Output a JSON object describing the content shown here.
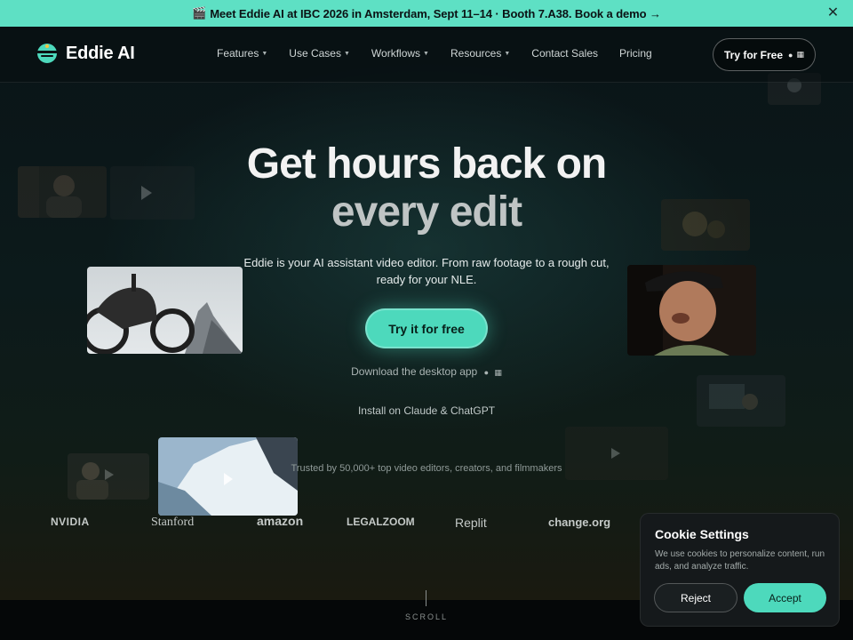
{
  "announcement": {
    "icon": "clapperboard-icon",
    "text": "Meet Eddie AI at IBC 2026 in Amsterdam, Sept 11–14 · Booth 7.A38. Book a demo →",
    "close": "✕"
  },
  "nav": {
    "brand": "Eddie AI",
    "items": [
      {
        "label": "Features",
        "dropdown": true
      },
      {
        "label": "Use Cases",
        "dropdown": true
      },
      {
        "label": "Workflows",
        "dropdown": true
      },
      {
        "label": "Resources",
        "dropdown": true
      },
      {
        "label": "Contact Sales",
        "dropdown": false
      },
      {
        "label": "Pricing",
        "dropdown": false
      }
    ],
    "cta": "Try for Free",
    "cta_icons": [
      "apple-icon",
      "windows-icon"
    ]
  },
  "hero": {
    "headline_line1": "Get hours back on",
    "headline_line2": "every edit",
    "subtext": "Eddie is your AI assistant video editor. From raw footage to a rough cut, ready for your NLE.",
    "primary_cta": "Try it for free",
    "download_text": "Download the desktop app",
    "install_text": "Install on Claude & ChatGPT",
    "trusted_text": "Trusted by 50,000+ top video editors, creators, and filmmakers"
  },
  "brands": [
    "NVIDIA",
    "Stanford",
    "amazon",
    "LEGALZOOM",
    "Replit",
    "change.org"
  ],
  "scroll_label": "SCROLL",
  "cookie": {
    "title": "Cookie Settings",
    "text": "We use cookies to personalize content, run ads, and analyze traffic.",
    "reject": "Reject",
    "accept": "Accept"
  },
  "colors": {
    "accent": "#5ee0c4",
    "button": "#4dd9bc",
    "background": "#0b1214"
  }
}
